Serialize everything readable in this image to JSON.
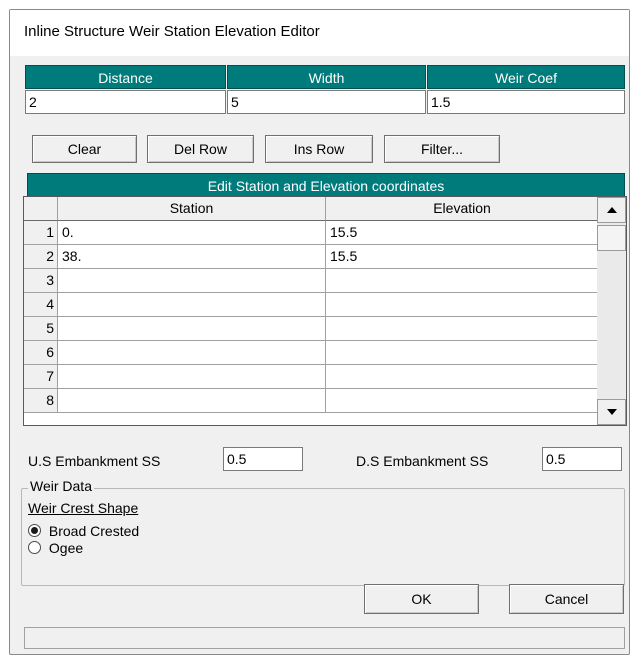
{
  "window": {
    "title": "Inline Structure Weir Station Elevation Editor"
  },
  "weir_params": {
    "headers": [
      "Distance",
      "Width",
      "Weir Coef"
    ],
    "values": [
      "2",
      "5",
      "1.5"
    ]
  },
  "toolbar": {
    "clear": "Clear",
    "del_row": "Del Row",
    "ins_row": "Ins Row",
    "filter": "Filter..."
  },
  "table": {
    "caption": "Edit Station and Elevation coordinates",
    "columns": [
      "Station",
      "Elevation"
    ],
    "rows": [
      {
        "n": "1",
        "station": "0.",
        "elevation": "15.5"
      },
      {
        "n": "2",
        "station": "38.",
        "elevation": "15.5"
      },
      {
        "n": "3",
        "station": "",
        "elevation": ""
      },
      {
        "n": "4",
        "station": "",
        "elevation": ""
      },
      {
        "n": "5",
        "station": "",
        "elevation": ""
      },
      {
        "n": "6",
        "station": "",
        "elevation": ""
      },
      {
        "n": "7",
        "station": "",
        "elevation": ""
      },
      {
        "n": "8",
        "station": "",
        "elevation": ""
      }
    ]
  },
  "embankment": {
    "us_label": "U.S Embankment SS",
    "us_value": "0.5",
    "ds_label": "D.S Embankment SS",
    "ds_value": "0.5"
  },
  "weir_data": {
    "group_label": "Weir Data",
    "crest_label": "Weir Crest Shape",
    "options": [
      {
        "label": "Broad Crested",
        "selected": true
      },
      {
        "label": "Ogee",
        "selected": false
      }
    ]
  },
  "footer": {
    "ok": "OK",
    "cancel": "Cancel"
  },
  "colors": {
    "header_teal": "#007b7b"
  },
  "icons": {
    "scroll_up": "arrow-up-icon",
    "scroll_down": "arrow-down-icon"
  }
}
